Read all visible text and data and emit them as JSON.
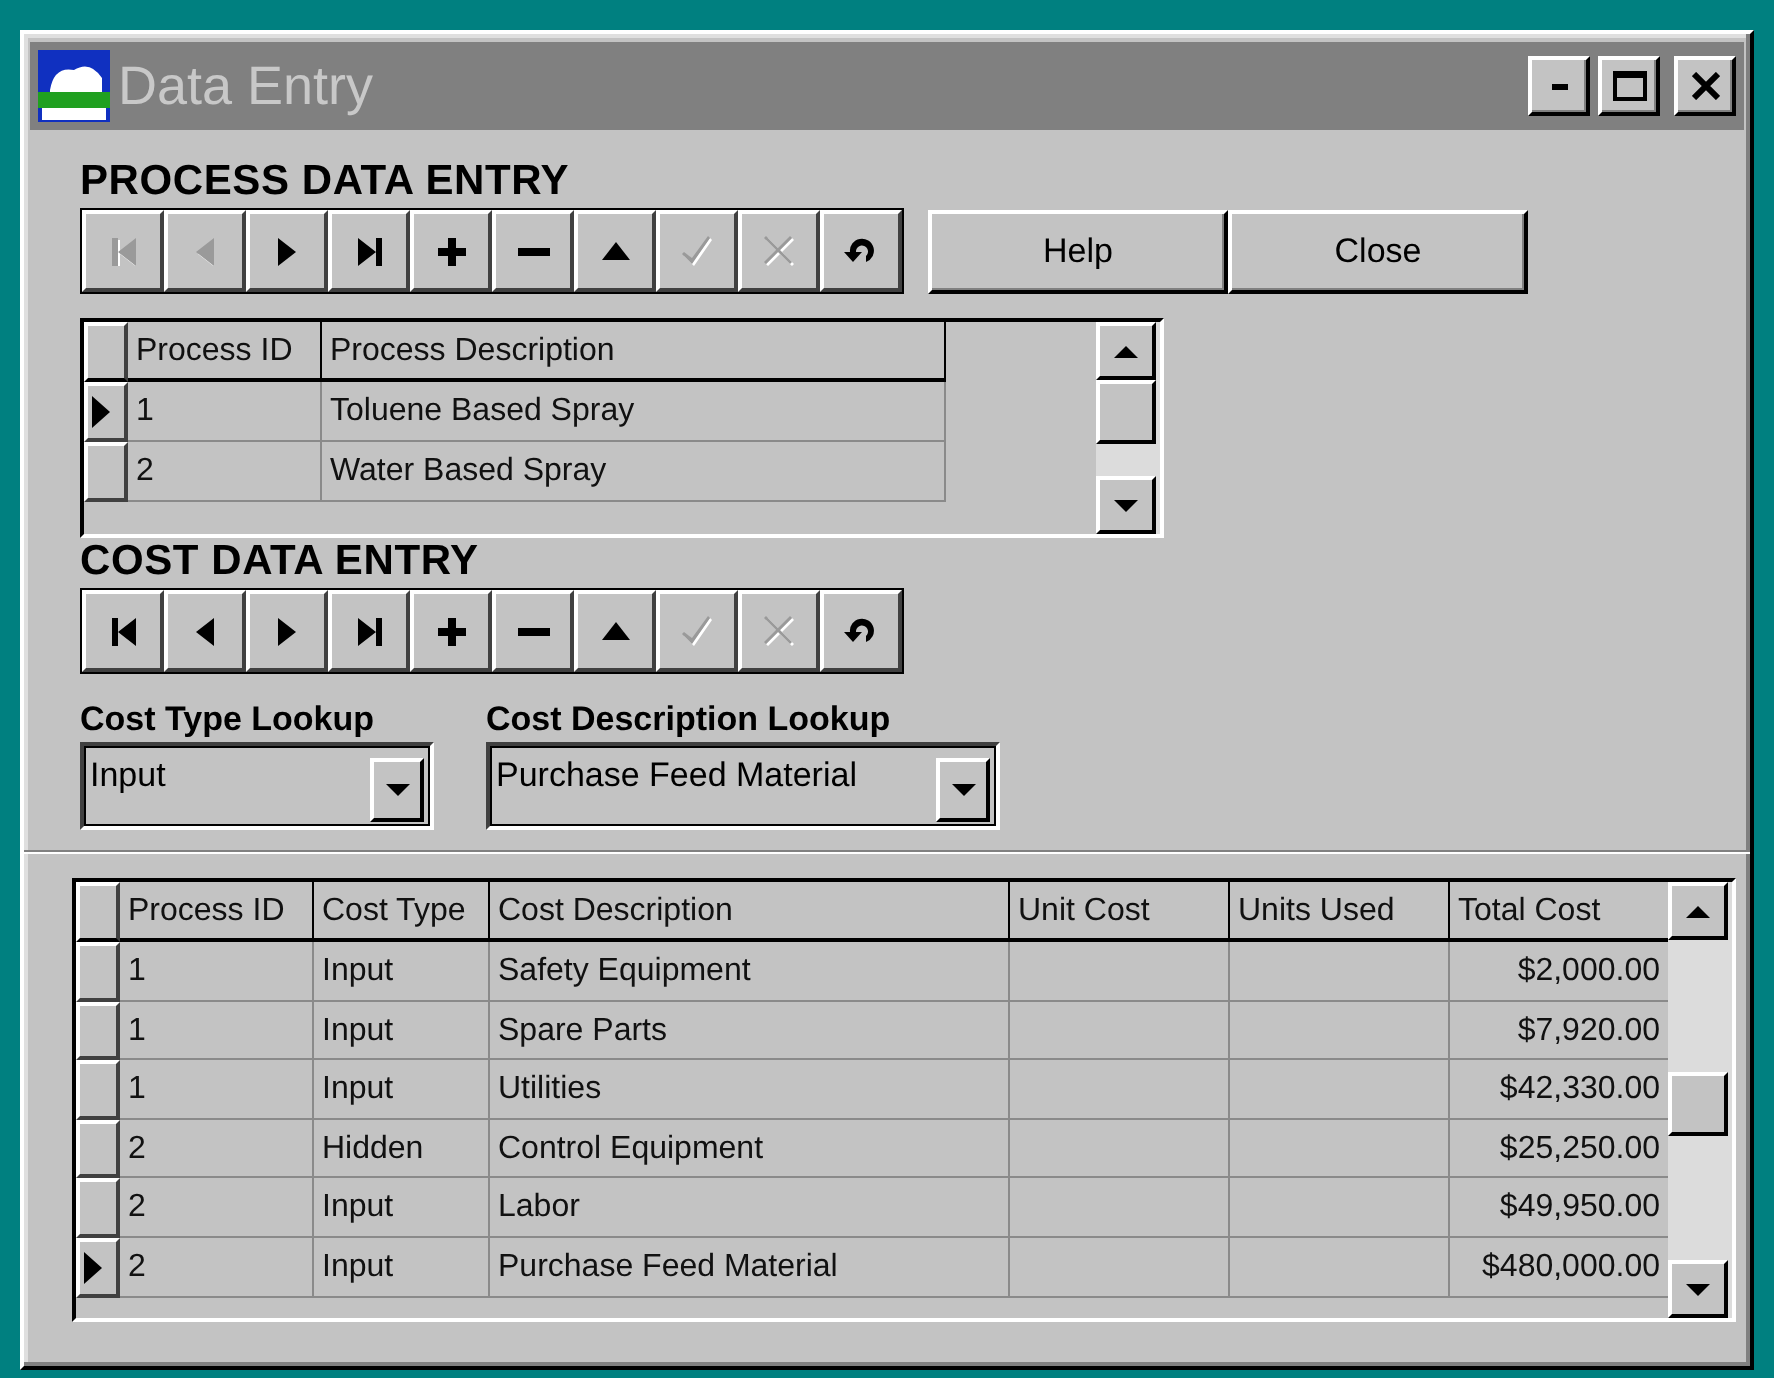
{
  "window": {
    "title": "Data Entry"
  },
  "process_section": {
    "heading": "PROCESS DATA ENTRY",
    "navigator": [
      {
        "kind": "first",
        "disabled": true
      },
      {
        "kind": "prior",
        "disabled": true
      },
      {
        "kind": "next",
        "disabled": false
      },
      {
        "kind": "last",
        "disabled": false
      },
      {
        "kind": "insert",
        "disabled": false
      },
      {
        "kind": "delete",
        "disabled": false
      },
      {
        "kind": "edit",
        "disabled": false
      },
      {
        "kind": "post",
        "disabled": true
      },
      {
        "kind": "cancel",
        "disabled": true
      },
      {
        "kind": "refresh",
        "disabled": false
      }
    ],
    "buttons": [
      "Help",
      "Close"
    ],
    "grid": {
      "columns": [
        "Process ID",
        "Process Description"
      ],
      "rows": [
        {
          "cells": [
            "1",
            "Toluene Based Spray"
          ],
          "selected": true
        },
        {
          "cells": [
            "2",
            "Water Based Spray"
          ],
          "selected": false
        }
      ]
    }
  },
  "cost_section": {
    "heading": "COST DATA ENTRY",
    "navigator": [
      {
        "kind": "first",
        "disabled": false
      },
      {
        "kind": "prior",
        "disabled": false
      },
      {
        "kind": "next",
        "disabled": false
      },
      {
        "kind": "last",
        "disabled": false
      },
      {
        "kind": "insert",
        "disabled": false
      },
      {
        "kind": "delete",
        "disabled": false
      },
      {
        "kind": "edit",
        "disabled": false
      },
      {
        "kind": "post",
        "disabled": true
      },
      {
        "kind": "cancel",
        "disabled": true
      },
      {
        "kind": "refresh",
        "disabled": false
      }
    ],
    "lookups": [
      {
        "label": "Cost Type Lookup",
        "value": "Input"
      },
      {
        "label": "Cost Description Lookup",
        "value": "Purchase Feed Material"
      }
    ]
  },
  "cost_grid": {
    "columns": [
      "Process ID",
      "Cost Type",
      "Cost Description",
      "Unit Cost",
      "Units Used",
      "Total Cost"
    ],
    "rows": [
      {
        "cells": [
          "1",
          "Input",
          "Safety Equipment",
          "$2,000.00"
        ],
        "selected": false
      },
      {
        "cells": [
          "1",
          "Input",
          "Spare Parts",
          "$7,920.00"
        ],
        "selected": false
      },
      {
        "cells": [
          "1",
          "Input",
          "Utilities",
          "$42,330.00"
        ],
        "selected": false
      },
      {
        "cells": [
          "2",
          "Hidden",
          "Control Equipment",
          "$25,250.00"
        ],
        "selected": false
      },
      {
        "cells": [
          "2",
          "Input",
          "Labor",
          "$49,950.00"
        ],
        "selected": false
      },
      {
        "cells": [
          "2",
          "Input",
          "Purchase Feed Material",
          "$480,000.00"
        ],
        "selected": true
      }
    ]
  }
}
